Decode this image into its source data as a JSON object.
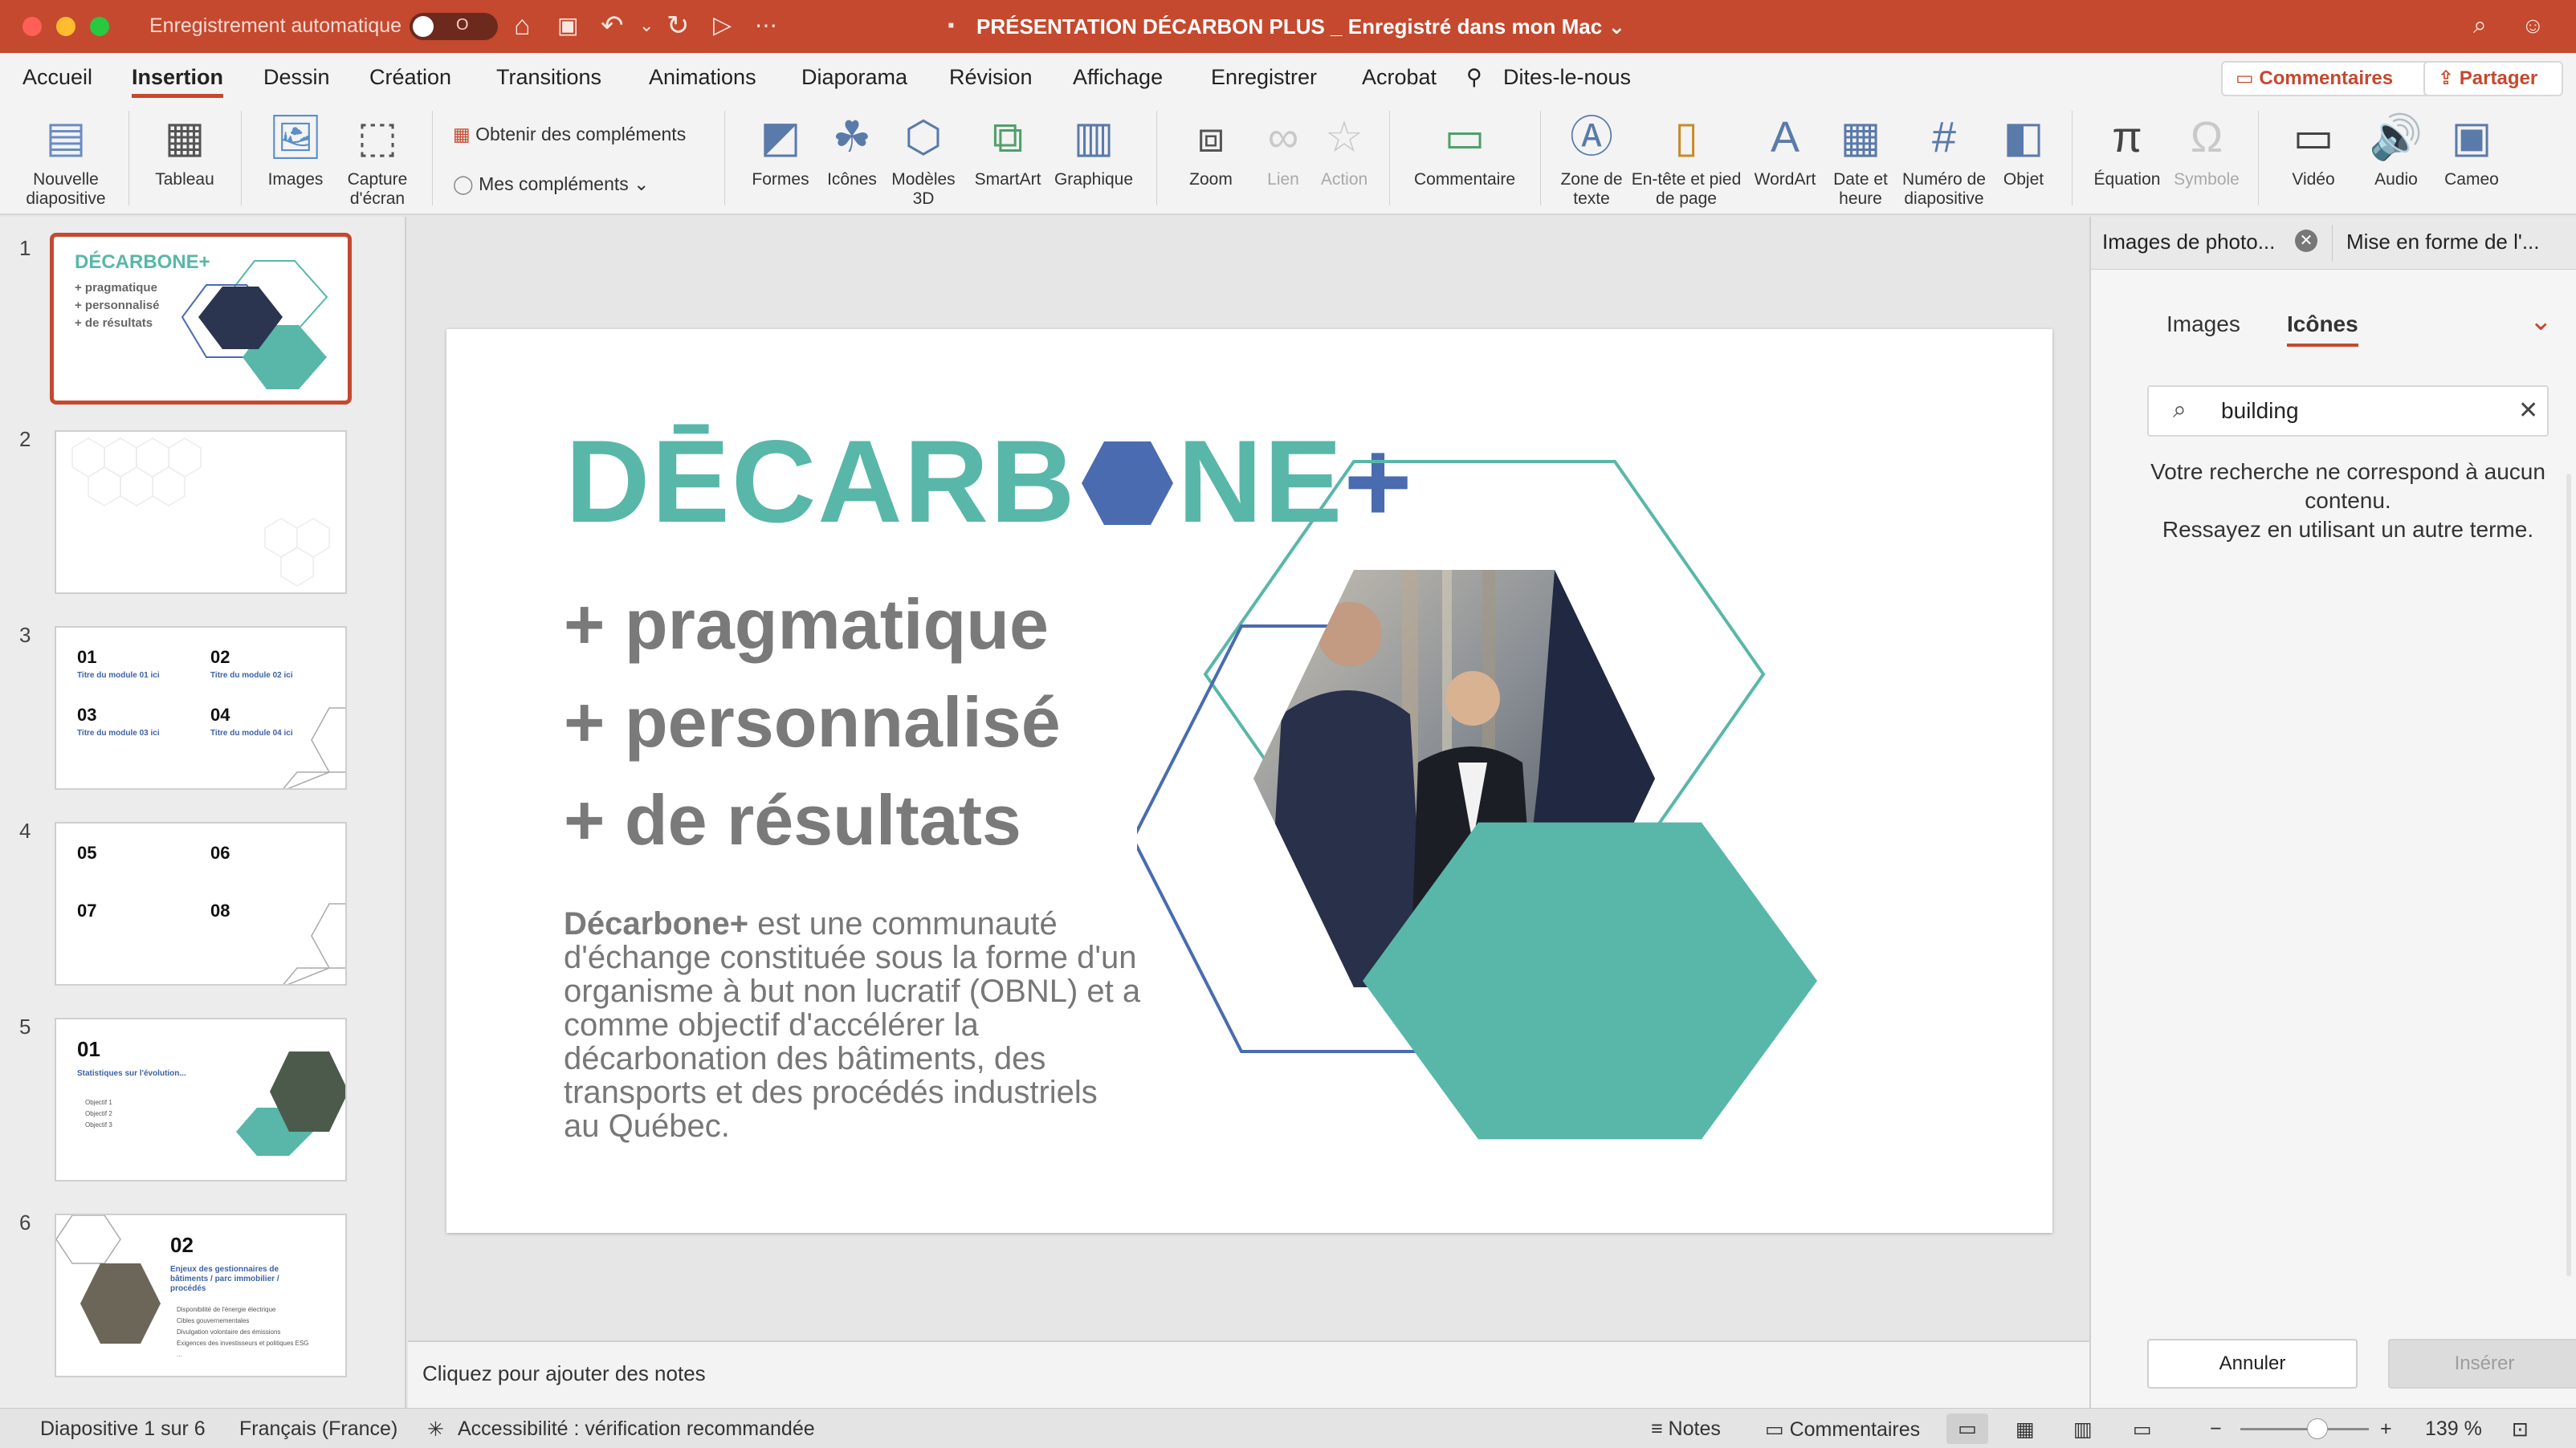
{
  "titlebar": {
    "autosave_label": "Enregistrement automatique",
    "autosave_state": "O",
    "doc_title": "PRÉSENTATION DÉCARBON PLUS _ Enregistré dans mon Mac",
    "colors": {
      "accent": "#c4492f"
    }
  },
  "tabs": {
    "items": [
      "Accueil",
      "Insertion",
      "Dessin",
      "Création",
      "Transitions",
      "Animations",
      "Diaporama",
      "Révision",
      "Affichage",
      "Enregistrer",
      "Acrobat",
      "Dites-le-nous"
    ],
    "active": "Insertion",
    "comments_btn": "Commentaires",
    "share_btn": "Partager"
  },
  "ribbon": {
    "new_slide": "Nouvelle diapositive",
    "table": "Tableau",
    "images": "Images",
    "screenshot": "Capture d'écran",
    "get_addins": "Obtenir des compléments",
    "my_addins": "Mes compléments",
    "shapes": "Formes",
    "icons": "Icônes",
    "models3d": "Modèles 3D",
    "smartart": "SmartArt",
    "chart": "Graphique",
    "zoom": "Zoom",
    "link": "Lien",
    "action": "Action",
    "comment": "Commentaire",
    "textbox": "Zone de texte",
    "header_footer": "En-tête et pied de page",
    "wordart": "WordArt",
    "datetime": "Date et heure",
    "slide_number": "Numéro de diapositive",
    "object": "Objet",
    "equation": "Équation",
    "symbol": "Symbole",
    "video": "Vidéo",
    "audio": "Audio",
    "cameo": "Cameo"
  },
  "thumbs": {
    "numbers": [
      "1",
      "2",
      "3",
      "4",
      "5",
      "6"
    ],
    "t1": {
      "logo": "DÉCARBONE+",
      "l1": "+ pragmatique",
      "l2": "+ personnalisé",
      "l3": "+ de résultats"
    },
    "t3": {
      "n1": "01",
      "n2": "02",
      "n3": "03",
      "n4": "04",
      "s1": "Titre du module 01 ici",
      "s2": "Titre du module 02 ici",
      "s3": "Titre du module 03 ici",
      "s4": "Titre du module 04 ici"
    },
    "t4": {
      "n1": "05",
      "n2": "06",
      "n3": "07",
      "n4": "08"
    },
    "t5": {
      "n": "01",
      "title": "Statistiques sur l'évolution...",
      "b1": "Objectif 1",
      "b2": "Objectif 2",
      "b3": "Objectif 3"
    },
    "t6": {
      "n": "02",
      "title": "Enjeux des gestionnaires de bâtiments / parc immobilier / procédés",
      "b1": "Disponibilité de l'énergie électrique",
      "b2": "Cibles gouvernementales",
      "b3": "Divulgation volontaire des émissions",
      "b4": "Exigences des investisseurs et politiques ESG",
      "b5": "..."
    }
  },
  "slide": {
    "logo_part1": "DĒCARB",
    "logo_part2": "NE",
    "logo_plus": "+",
    "taglines": [
      "+ pragmatique",
      "+ personnalisé",
      "+ de résultats"
    ],
    "desc_bold": "Décarbone+",
    "desc_rest": " est une communauté d'échange constituée sous la forme d'un organisme à but non lucratif (OBNL) et a comme objectif d'accélérer la décarbonation des bâtiments, des transports et des procédés industriels au Québec.",
    "colors": {
      "teal": "#58b7a8",
      "blue": "#4a6bb0",
      "gray": "#7a7a7a"
    }
  },
  "notes": {
    "placeholder": "Cliquez pour ajouter des notes"
  },
  "rpane": {
    "tab1": "Images de photo...",
    "tab2": "Mise en forme de l'...",
    "sub_images": "Images",
    "sub_icons": "Icônes",
    "search_value": "building",
    "no_result": "Votre recherche ne correspond à aucun contenu.",
    "try_other": "Ressayez en utilisant un autre terme.",
    "cancel": "Annuler",
    "insert": "Insérer"
  },
  "status": {
    "slide_info": "Diapositive 1 sur 6",
    "language": "Français (France)",
    "accessibility": "Accessibilité : vérification recommandée",
    "notes": "Notes",
    "comments": "Commentaires",
    "zoom": "139 %",
    "zoom_level": 0.6
  }
}
